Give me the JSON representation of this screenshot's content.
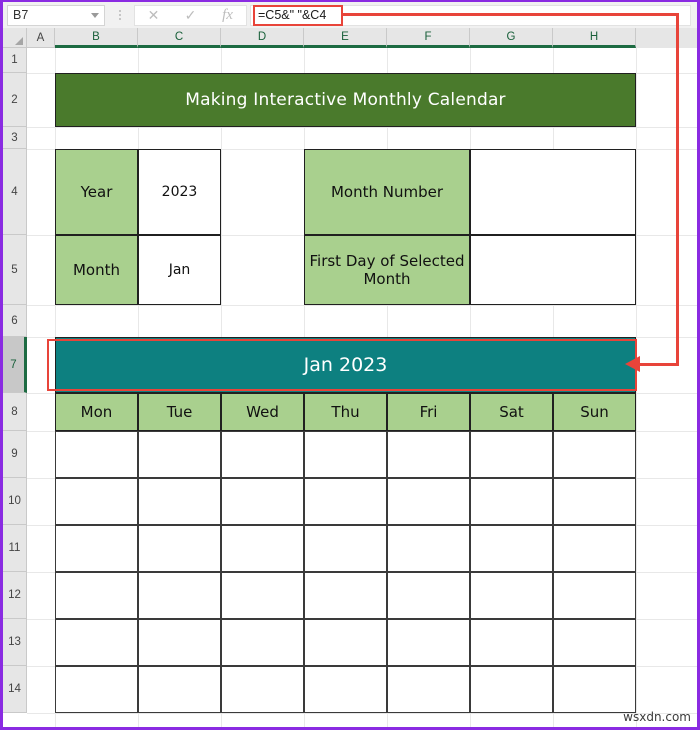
{
  "formula_bar": {
    "name_box_value": "B7",
    "name_box_caret": "chevron-down-icon",
    "cancel_icon": "✕",
    "enter_icon": "✓",
    "function_icon": "fx",
    "formula_value": "=C5&\" \"&C4",
    "highlight_color": "#e8443a"
  },
  "grid": {
    "column_headers": [
      "A",
      "B",
      "C",
      "D",
      "E",
      "F",
      "G",
      "H"
    ],
    "selected_columns": [
      "B",
      "C",
      "D",
      "E",
      "F",
      "G",
      "H"
    ],
    "row_headers": [
      "1",
      "2",
      "3",
      "4",
      "5",
      "6",
      "7",
      "8",
      "9",
      "10",
      "11",
      "12",
      "13",
      "14"
    ],
    "selected_row": "7",
    "active_cell": "B7"
  },
  "sheet": {
    "title_banner": {
      "text": "Making Interactive Monthly Calendar",
      "fill": "#4a7a2c",
      "text_color": "#ffffff"
    },
    "input_table": {
      "rows": [
        {
          "label": "Year",
          "value": "2023"
        },
        {
          "label": "Month",
          "value": "Jan"
        }
      ],
      "label_fill": "#a9d08e",
      "value_fill": "#ffffff"
    },
    "helper_table": {
      "rows": [
        {
          "label": "Month Number",
          "value": ""
        },
        {
          "label": "First Day of Selected Month",
          "value": ""
        }
      ],
      "label_fill": "#a9d08e",
      "value_fill": "#ffffff"
    },
    "month_banner": {
      "text": "Jan 2023",
      "fill": "#0d8080",
      "text_color": "#ffffff"
    },
    "calendar": {
      "day_headers": [
        "Mon",
        "Tue",
        "Wed",
        "Thu",
        "Fri",
        "Sat",
        "Sun"
      ],
      "header_fill": "#a9d08e",
      "weeks": [
        [
          "",
          "",
          "",
          "",
          "",
          "",
          ""
        ],
        [
          "",
          "",
          "",
          "",
          "",
          "",
          ""
        ],
        [
          "",
          "",
          "",
          "",
          "",
          "",
          ""
        ],
        [
          "",
          "",
          "",
          "",
          "",
          "",
          ""
        ],
        [
          "",
          "",
          "",
          "",
          "",
          "",
          ""
        ],
        [
          "",
          "",
          "",
          "",
          "",
          "",
          ""
        ]
      ]
    }
  },
  "annotation": {
    "callout_color": "#e8443a",
    "arrow_icon": "left-arrow-icon"
  },
  "watermark": {
    "text": "wsxdn.com"
  }
}
